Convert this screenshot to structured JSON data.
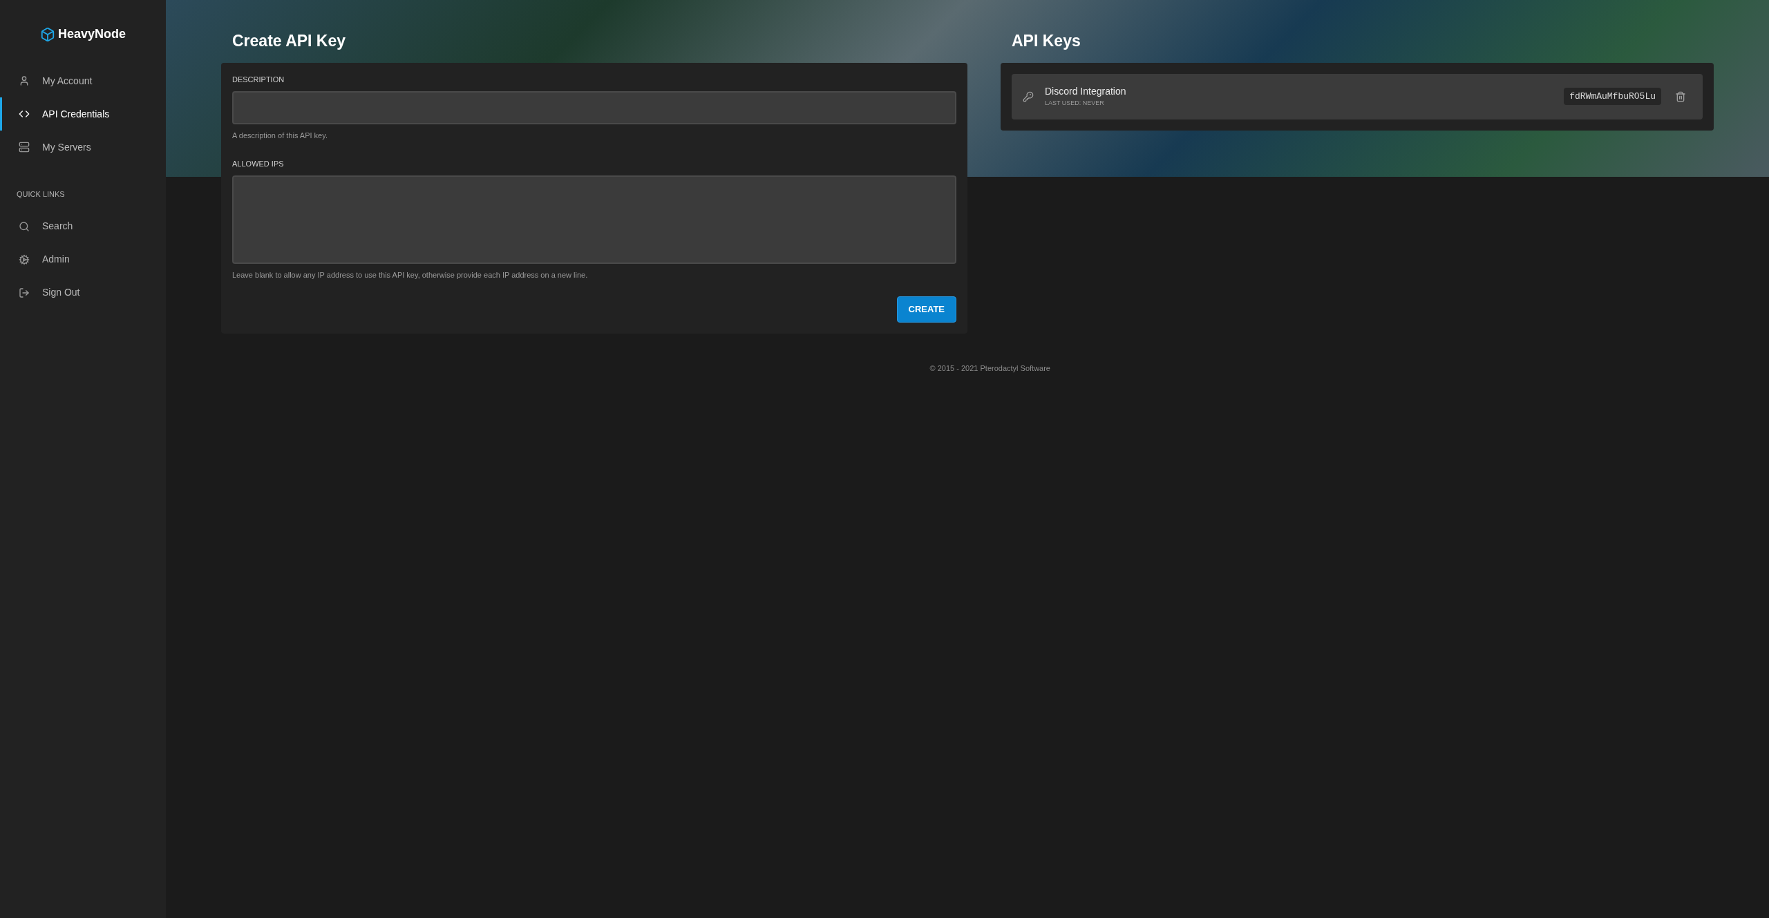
{
  "brand": {
    "name": "HeavyNode"
  },
  "sidebar": {
    "items": [
      {
        "label": "My Account",
        "kind": "user",
        "selected": false
      },
      {
        "label": "API Credentials",
        "kind": "code",
        "selected": true
      },
      {
        "label": "My Servers",
        "kind": "servers",
        "selected": false
      }
    ],
    "quick_links_heading": "QUICK LINKS",
    "quick_links": [
      {
        "label": "Search",
        "kind": "search"
      },
      {
        "label": "Admin",
        "kind": "cogs"
      },
      {
        "label": "Sign Out",
        "kind": "signout"
      }
    ]
  },
  "create_panel": {
    "title": "Create API Key",
    "description_label": "DESCRIPTION",
    "description_help": "A description of this API key.",
    "ips_label": "ALLOWED IPS",
    "ips_help": "Leave blank to allow any IP address to use this API key, otherwise provide each IP address on a new line.",
    "button": "CREATE"
  },
  "keys_panel": {
    "title": "API Keys",
    "keys": [
      {
        "name": "Discord Integration",
        "last_used": "LAST USED: NEVER",
        "identifier": "fdRWmAuMfbuRO5Lu"
      }
    ]
  },
  "footer": "© 2015 - 2021 Pterodactyl Software"
}
